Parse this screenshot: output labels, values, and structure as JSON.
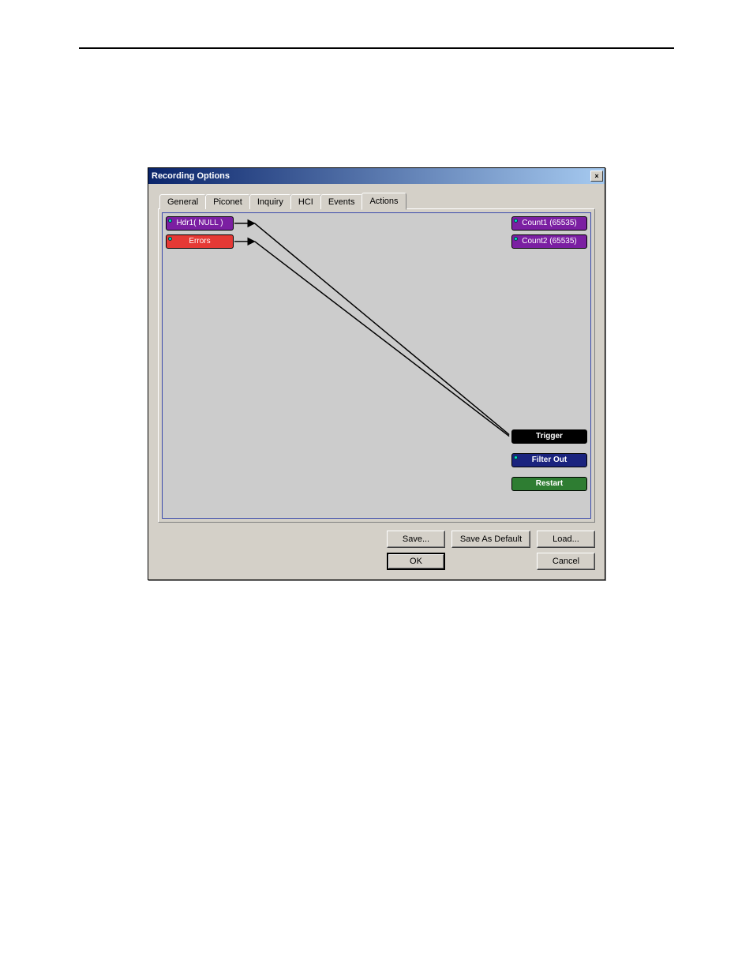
{
  "dialog": {
    "title": "Recording Options",
    "close_glyph": "×"
  },
  "tabs": {
    "general": "General",
    "piconet": "Piconet",
    "inquiry": "Inquiry",
    "hci": "HCI",
    "events": "Events",
    "actions": "Actions"
  },
  "nodes": {
    "hdr1": "Hdr1( NULL )",
    "errors": "Errors",
    "count1": "Count1 (65535)",
    "count2": "Count2 (65535)",
    "trigger": "Trigger",
    "filter_out": "Filter Out",
    "restart": "Restart"
  },
  "buttons": {
    "save": "Save...",
    "save_default": "Save As Default",
    "load": "Load...",
    "ok": "OK",
    "cancel": "Cancel"
  }
}
